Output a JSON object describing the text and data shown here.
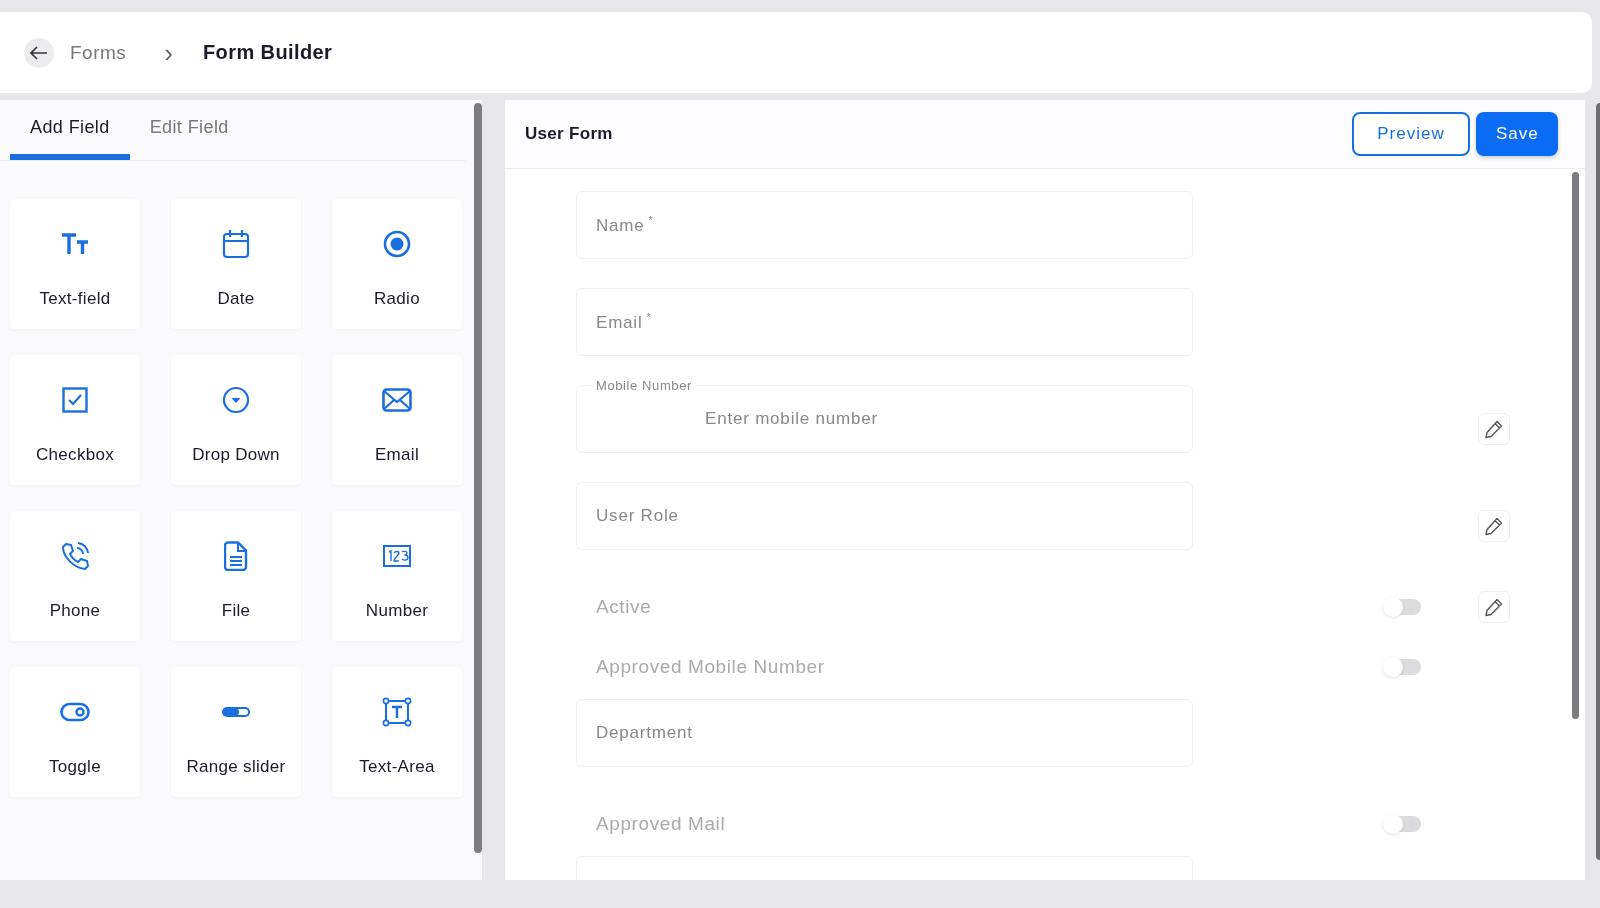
{
  "breadcrumb": {
    "parent": "Forms",
    "separator": "›",
    "current": "Form Builder"
  },
  "tabs": [
    {
      "label": "Add Field",
      "selected": true
    },
    {
      "label": "Edit Field",
      "selected": false
    }
  ],
  "palette": [
    {
      "kind": "text",
      "label": "Text-field"
    },
    {
      "kind": "date",
      "label": "Date"
    },
    {
      "kind": "radio",
      "label": "Radio"
    },
    {
      "kind": "checkbox",
      "label": "Checkbox"
    },
    {
      "kind": "dropdown",
      "label": "Drop Down"
    },
    {
      "kind": "email",
      "label": "Email"
    },
    {
      "kind": "phone",
      "label": "Phone"
    },
    {
      "kind": "file",
      "label": "File"
    },
    {
      "kind": "number",
      "label": "Number"
    },
    {
      "kind": "toggle",
      "label": "Toggle"
    },
    {
      "kind": "range",
      "label": "Range slider"
    },
    {
      "kind": "textarea",
      "label": "Text-Area"
    }
  ],
  "form": {
    "title": "User Form",
    "buttons": [
      {
        "kind": "outline",
        "label": "Preview"
      },
      {
        "kind": "primary",
        "label": "Save"
      }
    ],
    "fields": [
      {
        "kind": "input",
        "placeholder": "Name",
        "mark": "*",
        "editable": false
      },
      {
        "kind": "input",
        "placeholder": "Email",
        "mark": "*",
        "editable": false
      },
      {
        "kind": "input",
        "label": "Mobile Number",
        "placeholder": "Enter mobile number",
        "editable": true
      },
      {
        "kind": "input",
        "placeholder": "User Role",
        "editable": true
      },
      {
        "kind": "toggle",
        "label": "Active",
        "on": false,
        "editable": true
      },
      {
        "kind": "toggle",
        "label": "Approved Mobile Number",
        "on": false,
        "editable": false
      },
      {
        "kind": "input",
        "placeholder": "Department",
        "editable": false
      },
      {
        "kind": "toggle",
        "label": "Approved Mail",
        "on": false,
        "editable": false
      },
      {
        "kind": "input",
        "editable": false
      }
    ]
  }
}
